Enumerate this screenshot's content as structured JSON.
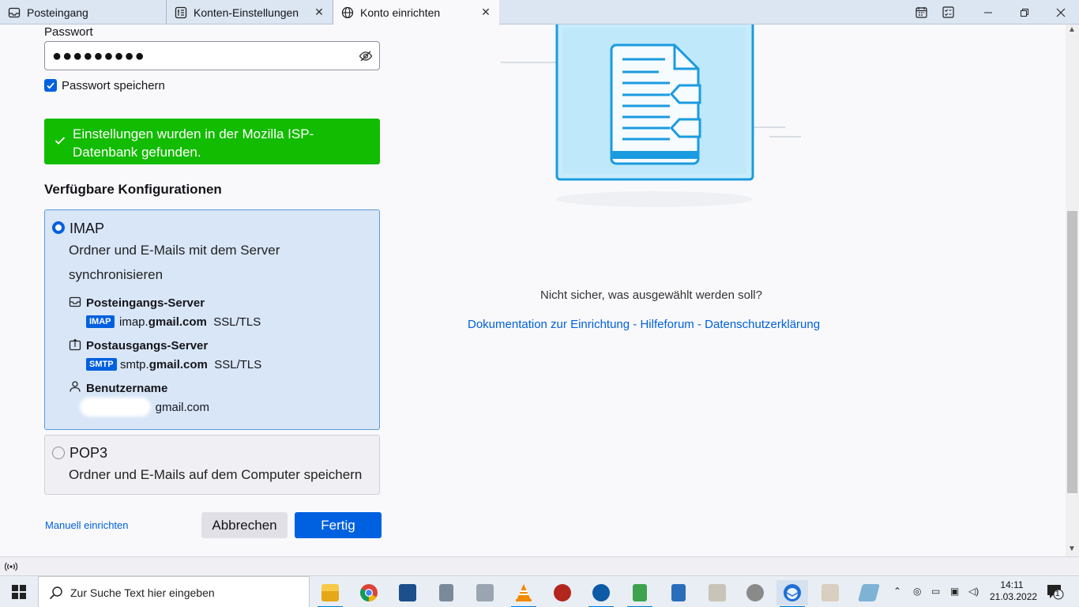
{
  "tabs": [
    {
      "label": "Posteingang",
      "icon": "inbox-icon"
    },
    {
      "label": "Konten-Einstellungen",
      "icon": "settings-page-icon"
    },
    {
      "label": "Konto einrichten",
      "icon": "globe-icon"
    }
  ],
  "form": {
    "password_label": "Passwort",
    "password_value": "●●●●●●●●●",
    "save_password_label": "Passwort speichern",
    "save_password_checked": true,
    "banner_text": "Einstellungen wurden in der Mozilla ISP-Datenbank gefunden.",
    "configs_heading": "Verfügbare Konfigurationen"
  },
  "imap": {
    "title": "IMAP",
    "description": "Ordner und E-Mails mit dem Server synchronisieren",
    "incoming_heading": "Posteingangs-Server",
    "incoming_badge": "IMAP",
    "incoming_host_prefix": "imap.",
    "incoming_host_domain": "gmail.com",
    "incoming_security": "SSL/TLS",
    "outgoing_heading": "Postausgangs-Server",
    "outgoing_badge": "SMTP",
    "outgoing_host_prefix": "smtp.",
    "outgoing_host_domain": "gmail.com",
    "outgoing_security": "SSL/TLS",
    "username_heading": "Benutzername",
    "username_value": "gmail.com"
  },
  "pop3": {
    "title": "POP3",
    "description": "Ordner und E-Mails auf dem Computer speichern"
  },
  "actions": {
    "manual_label": "Manuell einrichten",
    "cancel_label": "Abbrechen",
    "done_label": "Fertig"
  },
  "help": {
    "not_sure": "Nicht sicher, was ausgewählt werden soll?",
    "doc_link": "Dokumentation zur Einrichtung",
    "forum_link": "Hilfeforum",
    "privacy_link": "Datenschutzerklärung",
    "separator": " - "
  },
  "taskbar": {
    "search_placeholder": "Zur Suche Text hier eingeben",
    "time": "14:11",
    "date": "21.03.2022",
    "notification_count": "1"
  },
  "colors": {
    "accent": "#0060df",
    "success": "#12bc00",
    "imap_bg": "#d8e6f7"
  }
}
